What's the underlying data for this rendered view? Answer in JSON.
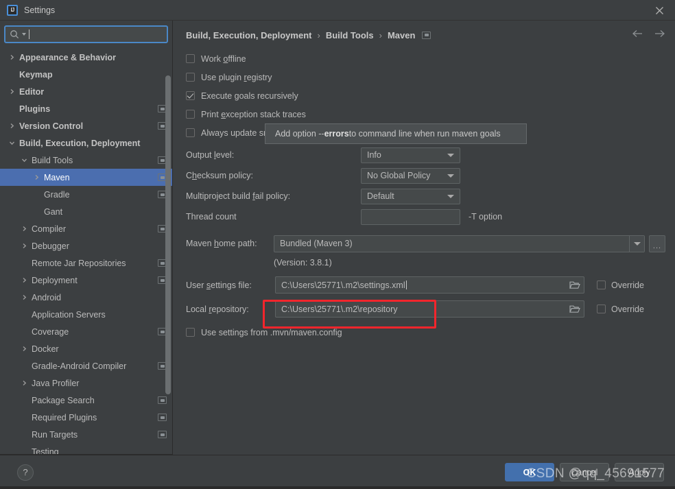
{
  "window": {
    "title": "Settings",
    "logo_text": "IJ",
    "close_icon": "close-icon"
  },
  "search": {
    "placeholder": "",
    "value": "",
    "icon": "search-icon"
  },
  "sidebar": {
    "items": [
      {
        "label": "Appearance & Behavior",
        "indent": 0,
        "arrow": "right",
        "bold": true,
        "badge": false,
        "selected": false
      },
      {
        "label": "Keymap",
        "indent": 0,
        "arrow": "none",
        "bold": true,
        "badge": false,
        "selected": false
      },
      {
        "label": "Editor",
        "indent": 0,
        "arrow": "right",
        "bold": true,
        "badge": false,
        "selected": false
      },
      {
        "label": "Plugins",
        "indent": 0,
        "arrow": "none",
        "bold": true,
        "badge": true,
        "selected": false
      },
      {
        "label": "Version Control",
        "indent": 0,
        "arrow": "right",
        "bold": true,
        "badge": true,
        "selected": false
      },
      {
        "label": "Build, Execution, Deployment",
        "indent": 0,
        "arrow": "down",
        "bold": true,
        "badge": false,
        "selected": false
      },
      {
        "label": "Build Tools",
        "indent": 1,
        "arrow": "down",
        "bold": false,
        "badge": true,
        "selected": false
      },
      {
        "label": "Maven",
        "indent": 2,
        "arrow": "right",
        "bold": false,
        "badge": true,
        "selected": true
      },
      {
        "label": "Gradle",
        "indent": 2,
        "arrow": "none",
        "bold": false,
        "badge": true,
        "selected": false
      },
      {
        "label": "Gant",
        "indent": 2,
        "arrow": "none",
        "bold": false,
        "badge": false,
        "selected": false
      },
      {
        "label": "Compiler",
        "indent": 1,
        "arrow": "right",
        "bold": false,
        "badge": true,
        "selected": false
      },
      {
        "label": "Debugger",
        "indent": 1,
        "arrow": "right",
        "bold": false,
        "badge": false,
        "selected": false
      },
      {
        "label": "Remote Jar Repositories",
        "indent": 1,
        "arrow": "none",
        "bold": false,
        "badge": true,
        "selected": false
      },
      {
        "label": "Deployment",
        "indent": 1,
        "arrow": "right",
        "bold": false,
        "badge": true,
        "selected": false
      },
      {
        "label": "Android",
        "indent": 1,
        "arrow": "right",
        "bold": false,
        "badge": false,
        "selected": false
      },
      {
        "label": "Application Servers",
        "indent": 1,
        "arrow": "none",
        "bold": false,
        "badge": false,
        "selected": false
      },
      {
        "label": "Coverage",
        "indent": 1,
        "arrow": "none",
        "bold": false,
        "badge": true,
        "selected": false
      },
      {
        "label": "Docker",
        "indent": 1,
        "arrow": "right",
        "bold": false,
        "badge": false,
        "selected": false
      },
      {
        "label": "Gradle-Android Compiler",
        "indent": 1,
        "arrow": "none",
        "bold": false,
        "badge": true,
        "selected": false
      },
      {
        "label": "Java Profiler",
        "indent": 1,
        "arrow": "right",
        "bold": false,
        "badge": false,
        "selected": false
      },
      {
        "label": "Package Search",
        "indent": 1,
        "arrow": "none",
        "bold": false,
        "badge": true,
        "selected": false
      },
      {
        "label": "Required Plugins",
        "indent": 1,
        "arrow": "none",
        "bold": false,
        "badge": true,
        "selected": false
      },
      {
        "label": "Run Targets",
        "indent": 1,
        "arrow": "none",
        "bold": false,
        "badge": true,
        "selected": false
      },
      {
        "label": "Testing",
        "indent": 1,
        "arrow": "none",
        "bold": false,
        "badge": false,
        "selected": false
      }
    ]
  },
  "breadcrumb": {
    "crumbs": [
      "Build, Execution, Deployment",
      "Build Tools",
      "Maven"
    ],
    "separator": "›",
    "back_icon": "arrow-left-icon",
    "forward_icon": "arrow-right-icon"
  },
  "checkboxes": [
    {
      "label_pre": "Work ",
      "mnemonic": "o",
      "label_post": "ffline",
      "checked": false
    },
    {
      "label_pre": "Use plugin ",
      "mnemonic": "r",
      "label_post": "egistry",
      "checked": false
    },
    {
      "label_pre": "Execute ",
      "mnemonic": "g",
      "label_post": "oals recursively",
      "checked": true
    },
    {
      "label_pre": "Print ",
      "mnemonic": "e",
      "label_post": "xception stack traces",
      "checked": false
    },
    {
      "label_pre": "Always update sn",
      "mnemonic": "",
      "label_post": "apshots",
      "checked": false
    }
  ],
  "tooltip": {
    "text_before": "Add option --",
    "bold": "errors",
    "text_after": " to command line when run maven goals"
  },
  "form": {
    "output_level": {
      "label_pre": "Output ",
      "mnemonic": "l",
      "label_post": "evel:",
      "value": "Info"
    },
    "checksum_policy": {
      "label_pre": "C",
      "mnemonic": "h",
      "label_post": "ecksum policy:",
      "value": "No Global Policy"
    },
    "fail_policy": {
      "label_pre": "Multiproject build ",
      "mnemonic": "f",
      "label_post": "ail policy:",
      "value": "Default"
    },
    "thread_count": {
      "label": "Thread count",
      "value": "",
      "hint": "-T option"
    }
  },
  "maven_home": {
    "label_pre": "Maven ",
    "mnemonic": "h",
    "label_post": "ome path:",
    "value": "Bundled (Maven 3)",
    "browse_label": "...",
    "version": "(Version: 3.8.1)"
  },
  "paths": {
    "user_settings": {
      "label_pre": "User ",
      "mnemonic": "s",
      "label_post": "ettings file:",
      "value": "C:\\Users\\25771\\.m2\\settings.xml",
      "folder_icon": "folder-icon",
      "override_label": "Override",
      "override_checked": false
    },
    "local_repository": {
      "label_pre": "Local ",
      "mnemonic": "r",
      "label_post": "epository:",
      "value": "C:\\Users\\25771\\.m2\\repository",
      "folder_icon": "folder-icon",
      "override_label": "Override",
      "override_checked": false,
      "highlight_color": "#f5252c"
    }
  },
  "mvn_config_checkbox": {
    "label": "Use settings from .mvn/maven.config",
    "checked": false
  },
  "footer": {
    "help_label": "?",
    "ok_label": "OK",
    "cancel_label": "Cancel",
    "apply_label": "Apply",
    "watermark": "CSDN @qq_45691577",
    "accent_color": "#4370ad"
  }
}
